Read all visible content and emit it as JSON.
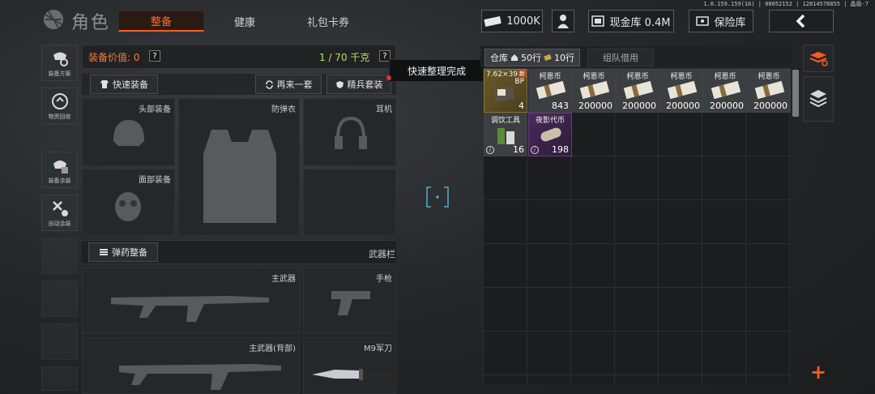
{
  "version_text": "1.0.159.159(16) | 08052152 | 12814578855 | 晶盾-7",
  "header": {
    "title": "角色",
    "tabs": [
      {
        "label": "整备",
        "active": true
      },
      {
        "label": "健康",
        "active": false
      },
      {
        "label": "礼包卡券",
        "active": false
      }
    ],
    "currency": "1000K",
    "cash_vault": "现金库 0.4M",
    "safe_vault": "保险库",
    "colors": {
      "accent": "#ff5a20",
      "weight_green": "#b6e05a"
    }
  },
  "left_sidebar": {
    "items": [
      {
        "label": "装备方案",
        "icon": "gear-loadout-icon"
      },
      {
        "label": "物资回收",
        "icon": "recycle-icon"
      },
      {
        "label": "装备涂装",
        "icon": "paint-icon"
      },
      {
        "label": "自动涂装",
        "icon": "auto-paint-icon"
      }
    ]
  },
  "equipment": {
    "value_label": "装备价值: 0",
    "help": "?",
    "weight": "1 / 70 千克",
    "buttons": {
      "quick_equip": "快速装备",
      "again": "再来一套",
      "elite": "精兵套装",
      "ammo": "弹药整备"
    },
    "slots": {
      "head": "头部装备",
      "armor": "防弹衣",
      "headset": "耳机",
      "face": "面部装备",
      "weapon_bar": "武器栏",
      "primary": "主武器",
      "pistol": "手枪",
      "primary_back": "主武器(背部)",
      "knife": "M9军刀"
    }
  },
  "toast": "快速整理完成",
  "warehouse": {
    "tabs": [
      {
        "label": "仓库",
        "rows_a": "50行",
        "rows_b": "10行",
        "active": true
      },
      {
        "label": "组队借用",
        "active": false
      }
    ],
    "items": [
      {
        "name": "7.62×39",
        "sub": "BP",
        "qty": "4",
        "kind": "ammo",
        "badge": "新"
      },
      {
        "name": "柯恩币",
        "qty": "843",
        "kind": "cash"
      },
      {
        "name": "柯恩币",
        "qty": "200000",
        "kind": "cash"
      },
      {
        "name": "柯恩币",
        "qty": "200000",
        "kind": "cash"
      },
      {
        "name": "柯恩币",
        "qty": "200000",
        "kind": "cash"
      },
      {
        "name": "柯恩币",
        "qty": "200000",
        "kind": "cash"
      },
      {
        "name": "柯恩币",
        "qty": "200000",
        "kind": "cash"
      },
      {
        "name": "调饮工具",
        "qty": "16",
        "kind": "tool",
        "info": "i"
      },
      {
        "name": "夜影代币",
        "qty": "198",
        "kind": "special",
        "info": "i"
      }
    ]
  },
  "right_sidebar": {
    "plus": "+"
  }
}
